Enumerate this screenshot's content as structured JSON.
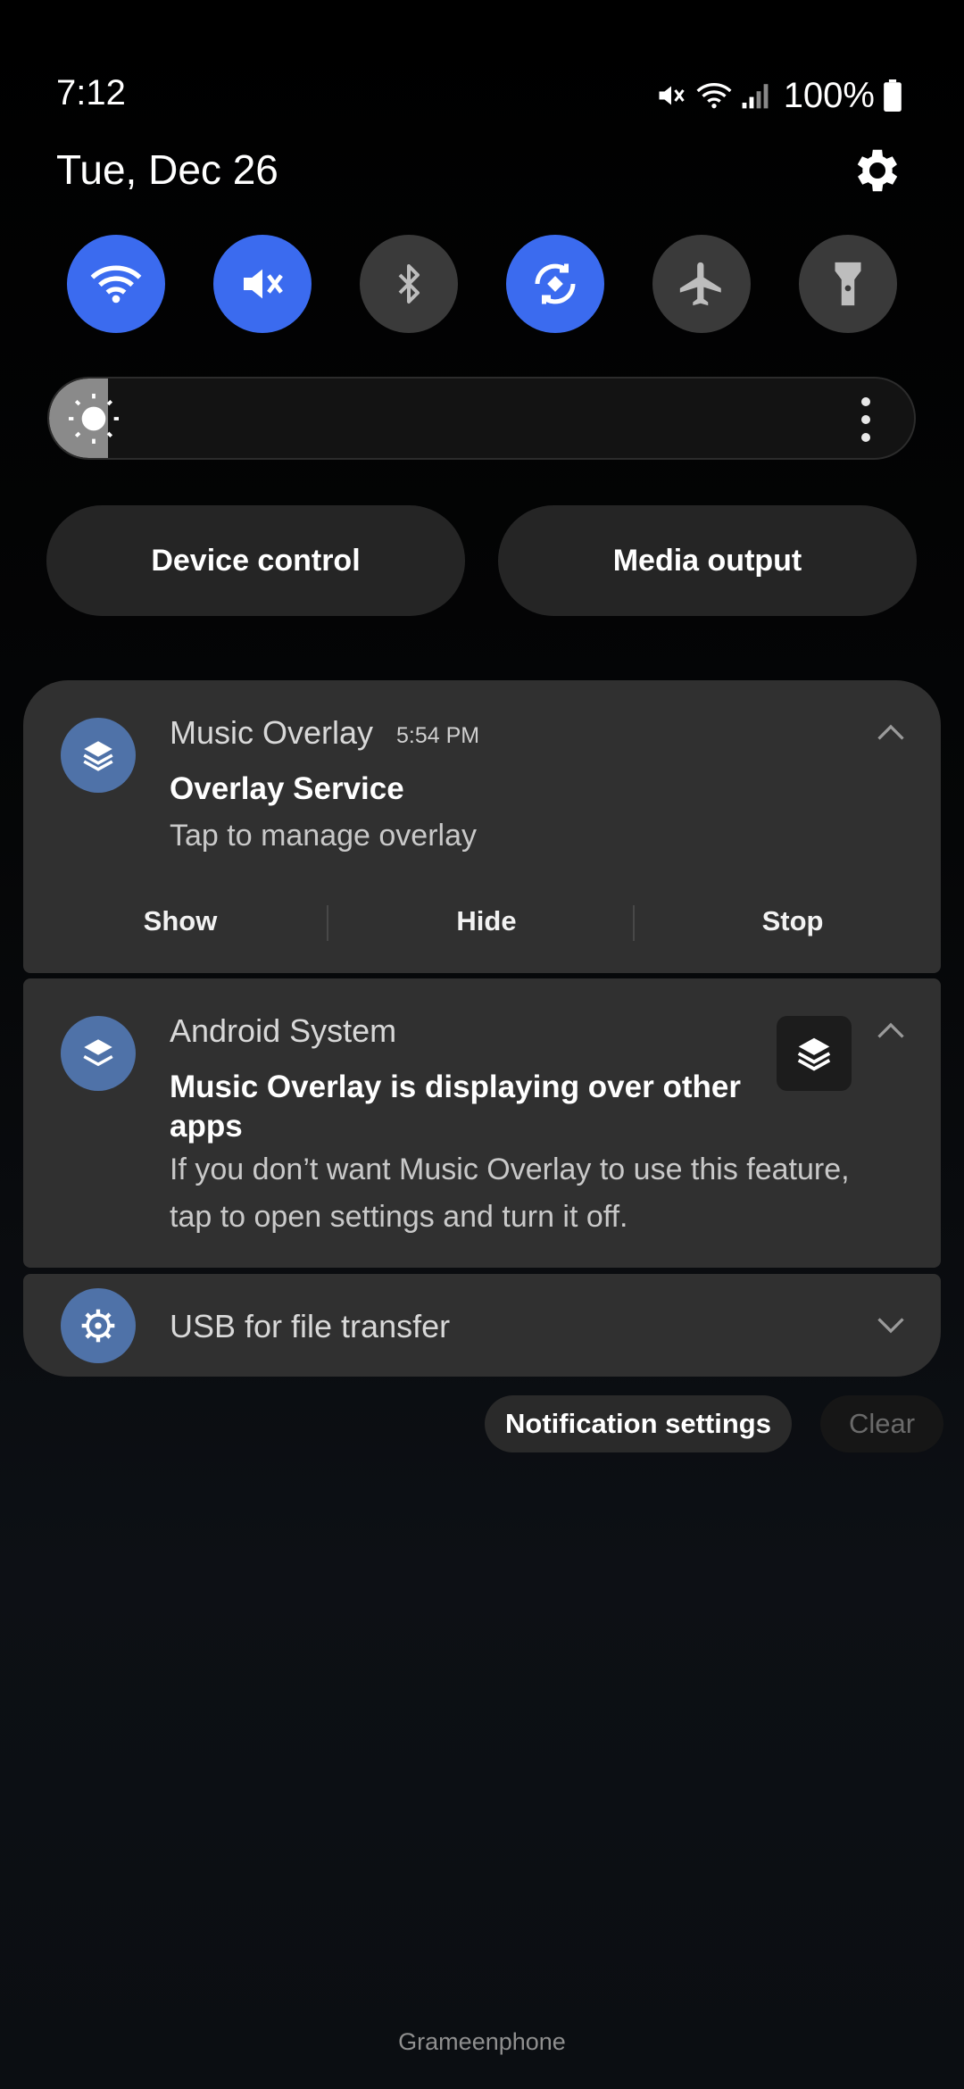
{
  "status_bar": {
    "time": "7:12",
    "battery": "100%",
    "icons": [
      "mute-icon",
      "wifi-icon",
      "signal-icon",
      "battery-icon"
    ]
  },
  "header": {
    "date": "Tue, Dec 26",
    "settings_icon": "gear-icon"
  },
  "quick_settings": [
    {
      "name": "Wi-Fi",
      "icon": "wifi-icon",
      "on": true
    },
    {
      "name": "Mute",
      "icon": "mute-icon",
      "on": true
    },
    {
      "name": "Bluetooth",
      "icon": "bluetooth-icon",
      "on": false
    },
    {
      "name": "Auto rotate",
      "icon": "rotate-icon",
      "on": true
    },
    {
      "name": "Airplane mode",
      "icon": "airplane-icon",
      "on": false
    },
    {
      "name": "Flashlight",
      "icon": "flashlight-icon",
      "on": false
    }
  ],
  "brightness": {
    "level": 0.05,
    "icon": "sun-icon"
  },
  "buttons": {
    "device_control": "Device control",
    "media_output": "Media output"
  },
  "notifications": [
    {
      "app": "Music Overlay",
      "time": "5:54 PM",
      "title": "Overlay Service",
      "text": "Tap to manage overlay",
      "actions": [
        "Show",
        "Hide",
        "Stop"
      ]
    },
    {
      "app": "Android System",
      "title_line1": "Music Overlay is displaying over other",
      "title_line2": "apps",
      "text_line1": "If you don’t want Music Overlay to use this feature,",
      "text_line2": "tap to open settings and turn it off."
    },
    {
      "app": "USB for file transfer"
    }
  ],
  "footer": {
    "notification_settings": "Notification settings",
    "clear": "Clear",
    "carrier": "Grameenphone"
  },
  "colors": {
    "accent": "#3b6bef",
    "app_icon": "#4f72a8",
    "card": "#303030"
  }
}
